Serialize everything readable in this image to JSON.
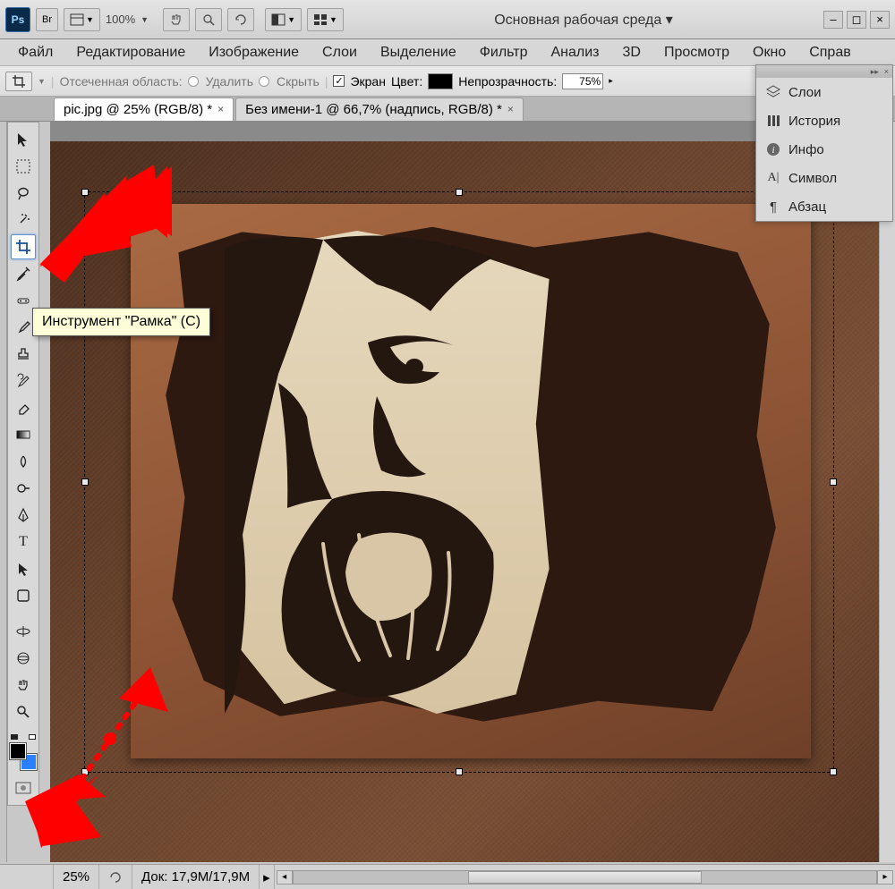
{
  "titlebar": {
    "ps_label": "Ps",
    "zoom": "100%",
    "workspace": "Основная рабочая среда ▾"
  },
  "menu": [
    "Файл",
    "Редактирование",
    "Изображение",
    "Слои",
    "Выделение",
    "Фильтр",
    "Анализ",
    "3D",
    "Просмотр",
    "Окно",
    "Справ"
  ],
  "options": {
    "section_label": "Отсеченная область:",
    "radio_delete": "Удалить",
    "radio_hide": "Скрыть",
    "check_screen": "Экран",
    "color_label": "Цвет:",
    "opacity_label": "Непрозрачность:",
    "opacity_value": "75%"
  },
  "tabs": [
    {
      "label": "pic.jpg @ 25% (RGB/8) *",
      "active": true
    },
    {
      "label": "Без имени-1 @ 66,7% (надпись, RGB/8) *",
      "active": false
    }
  ],
  "tooltip": "Инструмент \"Рамка\" (C)",
  "panels": [
    "Слои",
    "История",
    "Инфо",
    "Символ",
    "Абзац"
  ],
  "status": {
    "zoom": "25%",
    "doc": "Док: 17,9M/17,9M"
  },
  "tools": [
    "move",
    "marquee",
    "lasso",
    "wand",
    "crop",
    "eyedropper",
    "spot-heal",
    "brush",
    "stamp",
    "history-brush",
    "eraser",
    "gradient",
    "blur",
    "dodge",
    "pen",
    "type",
    "path-select",
    "shape",
    "3d-rotate",
    "3d-orbit",
    "hand",
    "zoom"
  ]
}
